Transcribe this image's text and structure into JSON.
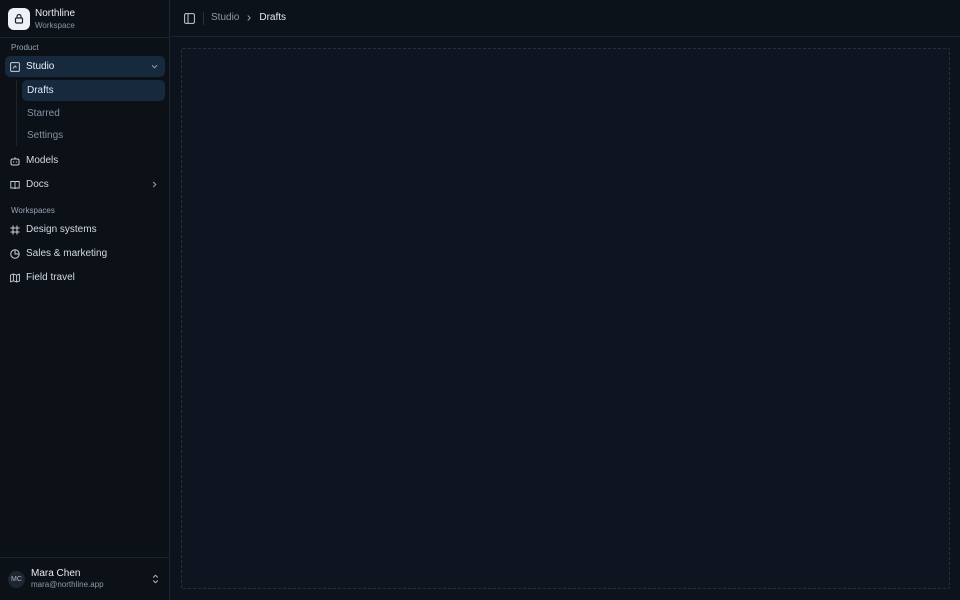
{
  "brand": {
    "name": "Northline",
    "subtitle": "Workspace"
  },
  "sidebar": {
    "product_label": "Product",
    "nav": [
      {
        "label": "Studio",
        "icon": "studio-icon",
        "expanded": true,
        "active": true,
        "children": [
          {
            "label": "Drafts",
            "active": true
          },
          {
            "label": "Starred",
            "active": false
          },
          {
            "label": "Settings",
            "active": false
          }
        ]
      },
      {
        "label": "Models",
        "icon": "bot-icon"
      },
      {
        "label": "Docs",
        "icon": "book-icon",
        "collapsed": true
      }
    ],
    "workspaces_label": "Workspaces",
    "workspaces": [
      {
        "label": "Design systems",
        "icon": "frame-icon"
      },
      {
        "label": "Sales & marketing",
        "icon": "pie-chart-icon"
      },
      {
        "label": "Field travel",
        "icon": "map-icon"
      }
    ]
  },
  "user": {
    "initials": "MC",
    "name": "Mara Chen",
    "email": "mara@northline.app"
  },
  "header": {
    "breadcrumb": [
      "Studio",
      "Drafts"
    ]
  },
  "colors": {
    "background": "#0d131c",
    "sidebar": "#0c1118",
    "active": "#17293d",
    "text": "#d3d9e2",
    "muted": "#8791a0"
  }
}
